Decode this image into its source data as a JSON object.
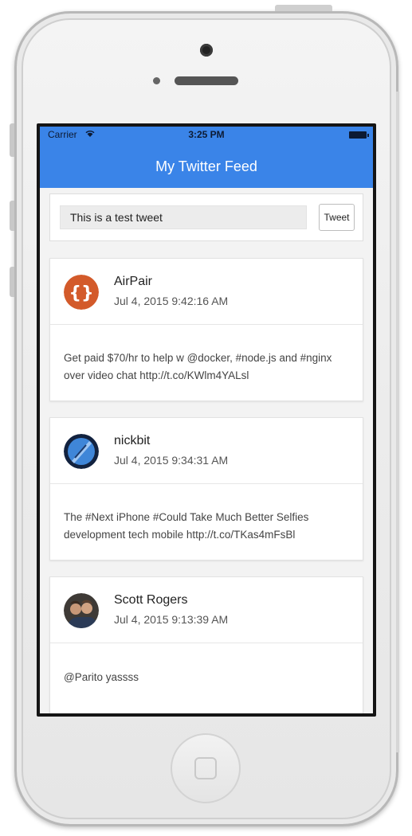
{
  "status_bar": {
    "carrier": "Carrier",
    "time": "3:25 PM"
  },
  "header": {
    "title": "My Twitter Feed",
    "accent_color": "#3a84e8"
  },
  "compose": {
    "input_value": "This is a test tweet",
    "button_label": "Tweet"
  },
  "tweets": [
    {
      "user": "AirPair",
      "timestamp": "Jul 4, 2015 9:42:16 AM",
      "text": "Get paid $70/hr to help w @docker, #node.js and #nginx over video chat http://t.co/KWlm4YALsl",
      "avatar_icon": "airpair-braces-logo"
    },
    {
      "user": "nickbit",
      "timestamp": "Jul 4, 2015 9:34:31 AM",
      "text": "The #Next iPhone #Could Take Much Better Selfies development tech mobile http://t.co/TKas4mFsBl",
      "avatar_icon": "nickbit-blue-avatar"
    },
    {
      "user": "Scott Rogers",
      "timestamp": "Jul 4, 2015 9:13:39 AM",
      "text": "@Parito yassss",
      "avatar_icon": "person-photo-avatar"
    }
  ]
}
